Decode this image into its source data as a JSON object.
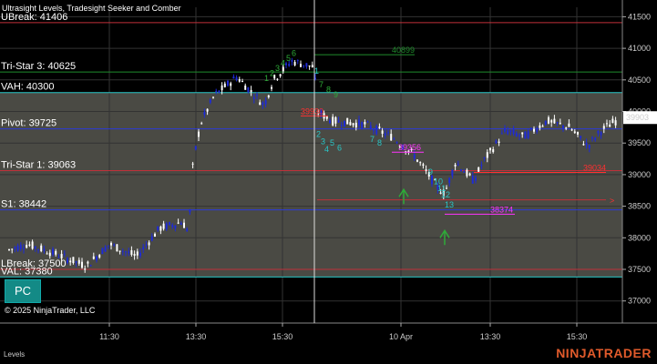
{
  "window": {
    "title": "Ultrasight Levels, Tradesight Seeker and Comber",
    "copyright": "© 2025 NinjaTrader, LLC",
    "footer_label": "Levels",
    "brand": "NINJATRADER",
    "pc_button": "PC"
  },
  "chart_data": {
    "type": "candlestick",
    "ylim": [
      36650,
      41650
    ],
    "y_ticks": [
      37000,
      37500,
      38000,
      38500,
      39000,
      39500,
      40000,
      40500,
      41000,
      41500
    ],
    "x_ticks": [
      "11:30",
      "13:30",
      "15:30",
      "10 Apr",
      "13:30",
      "15:30"
    ],
    "last_price": 39903,
    "colors": {
      "up": "#ffffff",
      "down": "#1e2bd6",
      "shade": "#4a4a44",
      "level_red": "#c0303a",
      "level_blue": "#2a3ad8",
      "level_green": "#1f8c2c",
      "level_cyan": "#29c7c7"
    },
    "levels": [
      {
        "label": "UBreak: 41406",
        "value": 41406,
        "color": "#c0303a"
      },
      {
        "label": "Tri-Star 3: 40625",
        "value": 40625,
        "color": "#1f8c2c"
      },
      {
        "label": "VAH: 40300",
        "value": 40300,
        "color": "#29c7c7"
      },
      {
        "label": "Pivot: 39725",
        "value": 39725,
        "color": "#2a3ad8"
      },
      {
        "label": "Tri-Star 1: 39063",
        "value": 39063,
        "color": "#c0303a"
      },
      {
        "label": "S1: 38442",
        "value": 38442,
        "color": "#2a3ad8"
      },
      {
        "label": "LBreak: 37500",
        "value": 37500,
        "color": "#c0303a"
      },
      {
        "label": "VAL: 37380",
        "value": 37380,
        "color": "#29c7c7"
      }
    ],
    "shade_range": [
      37380,
      40300
    ],
    "price_annotations": [
      {
        "text": "40899",
        "value": 40899,
        "color": "#1f8c2c"
      },
      {
        "text": "39930",
        "value": 39930,
        "color": "#ff3030"
      },
      {
        "text": "39356",
        "value": 39356,
        "color": "#ff33ff"
      },
      {
        "text": "39034",
        "value": 39034,
        "color": "#ff3030"
      },
      {
        "text": "38374",
        "value": 38374,
        "color": "#ff33ff"
      }
    ],
    "sequence_counts_green": [
      "1",
      "2",
      "3",
      "4",
      "5",
      "6",
      "7",
      "8",
      "9"
    ],
    "sequence_counts_cyan": [
      "1",
      "2",
      "3",
      "4",
      "5",
      "6",
      "7",
      "8",
      "9",
      "10",
      "11",
      "12",
      "13"
    ]
  }
}
